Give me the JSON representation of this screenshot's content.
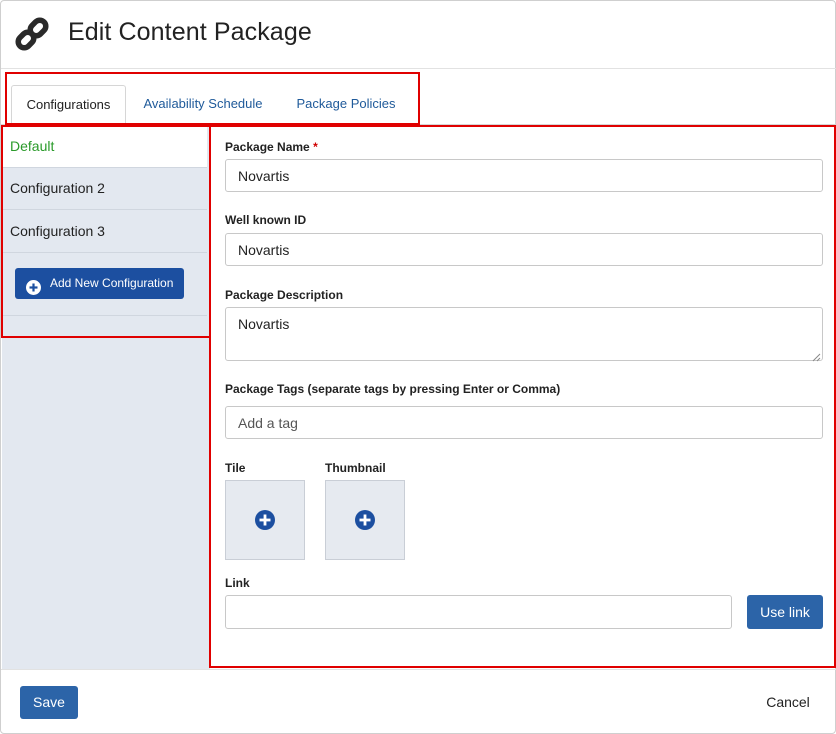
{
  "header": {
    "title": "Edit Content Package",
    "icon": "link-icon"
  },
  "tabs": [
    {
      "label": "Configurations",
      "active": true
    },
    {
      "label": "Availability Schedule",
      "active": false
    },
    {
      "label": "Package Policies",
      "active": false
    }
  ],
  "sidebar": {
    "items": [
      {
        "label": "Default",
        "selected": true
      },
      {
        "label": "Configuration 2",
        "selected": false
      },
      {
        "label": "Configuration 3",
        "selected": false
      }
    ],
    "add_button_label": "Add New Configuration"
  },
  "form": {
    "package_name_label": "Package Name",
    "required_marker": "*",
    "package_name_value": "Novartis",
    "well_known_id_label": "Well known ID",
    "well_known_id_value": "Novartis",
    "description_label": "Package Description",
    "description_value": "Novartis",
    "tags_label": "Package Tags (separate tags by pressing Enter or Comma)",
    "tags_placeholder": "Add a tag",
    "tile_label": "Tile",
    "thumbnail_label": "Thumbnail",
    "link_label": "Link",
    "link_value": "",
    "use_link_label": "Use link"
  },
  "footer": {
    "save_label": "Save",
    "cancel_label": "Cancel"
  },
  "colors": {
    "primary_button": "#2c64a8",
    "add_config_button": "#1c4fa0",
    "selected_item_text": "#2a9a2a",
    "highlight_border": "#e00000",
    "sidebar_bg": "#e3e8f0",
    "tab_link": "#1f5a9a"
  }
}
